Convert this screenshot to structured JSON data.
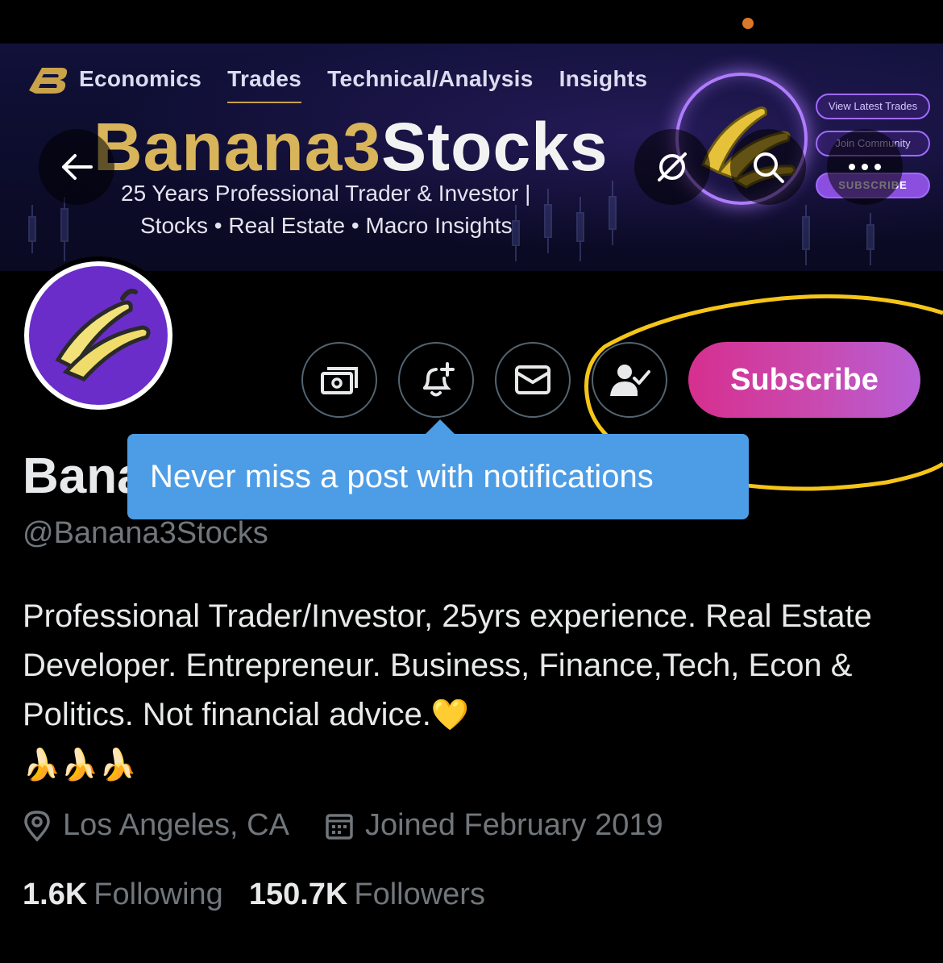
{
  "banner": {
    "nav": [
      "Economics",
      "Trades",
      "Technical/Analysis",
      "Insights"
    ],
    "active_nav": "Trades",
    "title_part1": "Banana3",
    "title_part2": "Stocks",
    "tagline": "25 Years Professional Trader & Investor |",
    "tagline2": "Stocks • Real Estate • Macro Insights",
    "pills": [
      "View Latest Trades",
      "Join Community",
      "SUBSCRIBE"
    ]
  },
  "header_icons": {
    "back": "back-arrow-icon",
    "grok": "grok-icon",
    "search": "search-icon",
    "more": "more-icon"
  },
  "actions": {
    "money": "money-icon",
    "bell": "bell-plus-icon",
    "mail": "mail-icon",
    "follow": "following-check-icon",
    "subscribe_label": "Subscribe"
  },
  "tooltip": {
    "text": "Never miss a post with notifications"
  },
  "profile": {
    "display_name": "Bana",
    "handle": "@Banana3Stocks",
    "bio": "Professional Trader/Investor, 25yrs experience. Real Estate Developer. Entrepreneur. Business, Finance,Tech, Econ & Politics. Not financial advice.",
    "bio_emoji": "💛",
    "bio_emoji_row": "🍌🍌🍌",
    "location": "Los Angeles, CA",
    "joined": "Joined February 2019"
  },
  "stats": {
    "following_count": "1.6K",
    "following_label": "Following",
    "followers_count": "150.7K",
    "followers_label": "Followers"
  },
  "colors": {
    "subscribe_gradient_start": "#d62f8f",
    "subscribe_gradient_end": "#b65ed6",
    "tooltip_bg": "#4d9de6",
    "annotation": "#f5c518",
    "muted_text": "#71767b"
  }
}
